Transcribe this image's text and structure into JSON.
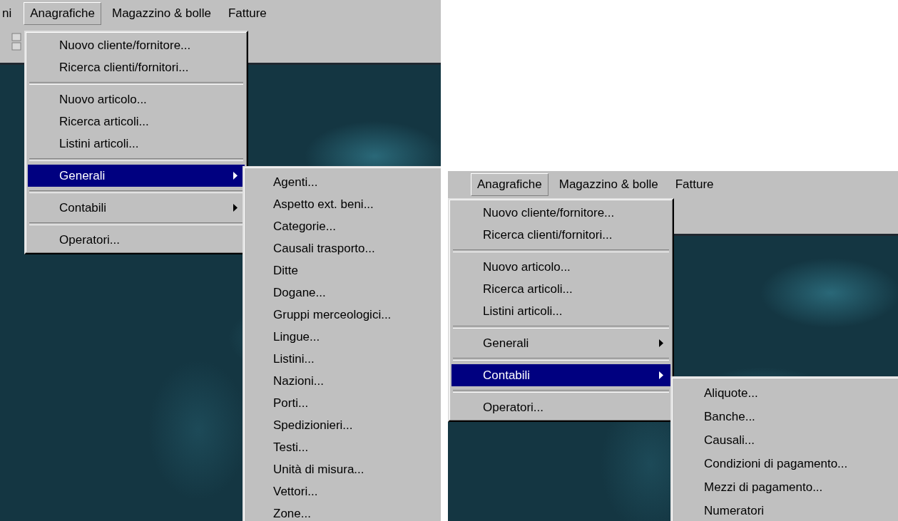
{
  "screenshots": [
    {
      "menu_bar": [
        {
          "label": "ni",
          "selected": false
        },
        {
          "label": "Anagrafiche",
          "selected": true
        },
        {
          "label": "Magazzino & bolle",
          "selected": false
        },
        {
          "label": "Fatture",
          "selected": false
        }
      ],
      "dropdown": [
        {
          "kind": "item",
          "label": "Nuovo cliente/fornitore..."
        },
        {
          "kind": "item",
          "label": "Ricerca clienti/fornitori..."
        },
        {
          "kind": "separator"
        },
        {
          "kind": "item",
          "label": "Nuovo articolo..."
        },
        {
          "kind": "item",
          "label": "Ricerca articoli..."
        },
        {
          "kind": "item",
          "label": "Listini articoli..."
        },
        {
          "kind": "separator"
        },
        {
          "kind": "submenu",
          "label": "Generali",
          "selected": true
        },
        {
          "kind": "separator"
        },
        {
          "kind": "submenu",
          "label": "Contabili",
          "selected": false
        },
        {
          "kind": "separator"
        },
        {
          "kind": "item",
          "label": "Operatori..."
        }
      ],
      "submenu": [
        "Agenti...",
        "Aspetto ext. beni...",
        "Categorie...",
        "Causali trasporto...",
        "Ditte",
        "Dogane...",
        "Gruppi merceologici...",
        "Lingue...",
        "Listini...",
        "Nazioni...",
        "Porti...",
        "Spedizionieri...",
        "Testi...",
        "Unità di misura...",
        "Vettori...",
        "Zone..."
      ]
    },
    {
      "menu_bar": [
        {
          "label": "Anagrafiche",
          "selected": true
        },
        {
          "label": "Magazzino & bolle",
          "selected": false
        },
        {
          "label": "Fatture",
          "selected": false
        }
      ],
      "dropdown": [
        {
          "kind": "item",
          "label": "Nuovo cliente/fornitore..."
        },
        {
          "kind": "item",
          "label": "Ricerca clienti/fornitori..."
        },
        {
          "kind": "separator"
        },
        {
          "kind": "item",
          "label": "Nuovo articolo..."
        },
        {
          "kind": "item",
          "label": "Ricerca articoli..."
        },
        {
          "kind": "item",
          "label": "Listini articoli..."
        },
        {
          "kind": "separator"
        },
        {
          "kind": "submenu",
          "label": "Generali",
          "selected": false
        },
        {
          "kind": "separator"
        },
        {
          "kind": "submenu",
          "label": "Contabili",
          "selected": true
        },
        {
          "kind": "separator"
        },
        {
          "kind": "item",
          "label": "Operatori..."
        }
      ],
      "submenu": [
        "Aliquote...",
        "Banche...",
        "Causali...",
        "Condizioni di pagamento...",
        "Mezzi di pagamento...",
        "Numeratori"
      ]
    }
  ]
}
